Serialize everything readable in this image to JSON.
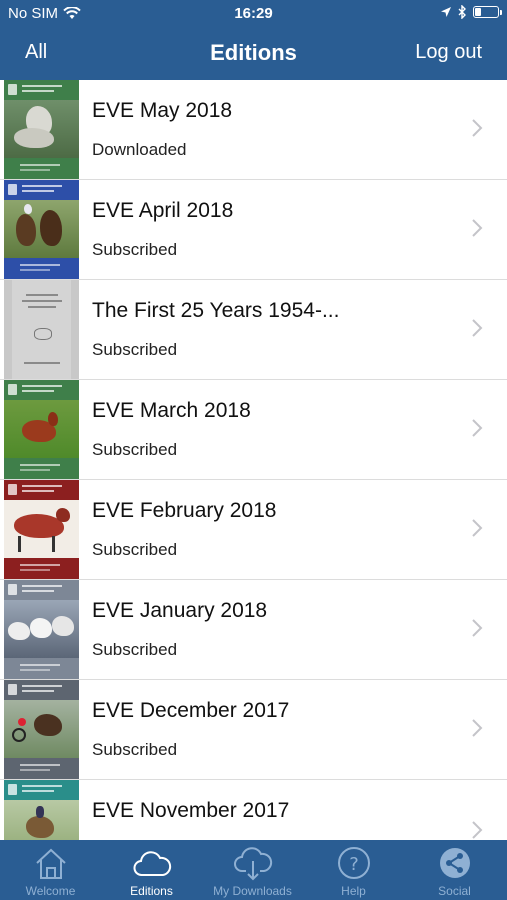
{
  "status": {
    "carrier": "No SIM",
    "time": "16:29"
  },
  "nav": {
    "left": "All",
    "title": "Editions",
    "right": "Log out"
  },
  "editions": [
    {
      "title": "EVE May 2018",
      "status": "Downloaded",
      "cover": "cover-may-2018"
    },
    {
      "title": "EVE April 2018",
      "status": "Subscribed",
      "cover": "cover-april-2018"
    },
    {
      "title": "The First 25 Years 1954-...",
      "status": "Subscribed",
      "cover": "cover-first-25-years"
    },
    {
      "title": "EVE March 2018",
      "status": "Subscribed",
      "cover": "cover-march-2018"
    },
    {
      "title": "EVE February 2018",
      "status": "Subscribed",
      "cover": "cover-february-2018"
    },
    {
      "title": "EVE January 2018",
      "status": "Subscribed",
      "cover": "cover-january-2018"
    },
    {
      "title": "EVE December 2017",
      "status": "Subscribed",
      "cover": "cover-december-2017"
    },
    {
      "title": "EVE November 2017",
      "status": "",
      "cover": "cover-november-2017"
    }
  ],
  "tabs": [
    {
      "label": "Welcome",
      "icon": "home-icon",
      "active": false
    },
    {
      "label": "Editions",
      "icon": "cloud-icon",
      "active": true
    },
    {
      "label": "My Downloads",
      "icon": "cloud-download-icon",
      "active": false
    },
    {
      "label": "Help",
      "icon": "help-icon",
      "active": false
    },
    {
      "label": "Social",
      "icon": "share-icon",
      "active": false
    }
  ],
  "colors": {
    "bar": "#2a5d93",
    "tab_active": "#ffffff",
    "tab_inactive": "#8fb0d3"
  }
}
